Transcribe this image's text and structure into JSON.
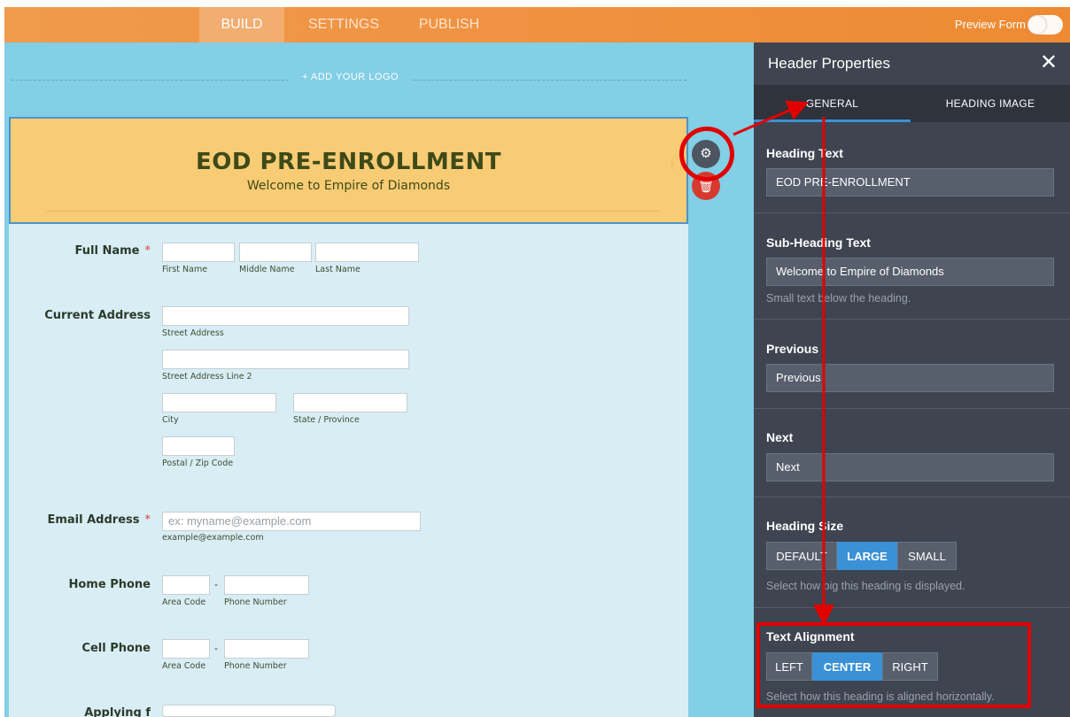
{
  "topbar": {
    "tabs": [
      "BUILD",
      "SETTINGS",
      "PUBLISH"
    ],
    "preview_label": "Preview Form"
  },
  "canvas": {
    "add_logo": "+ ADD YOUR LOGO",
    "heading_title": "EOD PRE-ENROLLMENT",
    "heading_subtitle": "Welcome to Empire of Diamonds"
  },
  "form": {
    "full_name": {
      "label": "Full Name",
      "required": "*",
      "sublabels": [
        "First Name",
        "Middle Name",
        "Last Name"
      ]
    },
    "address": {
      "label": "Current Address",
      "sublabels": [
        "Street Address",
        "Street Address Line 2",
        "City",
        "State / Province",
        "Postal / Zip Code"
      ]
    },
    "email": {
      "label": "Email Address",
      "required": "*",
      "placeholder": "ex: myname@example.com",
      "sublabel": "example@example.com"
    },
    "home_phone": {
      "label": "Home Phone",
      "dash": "-",
      "sublabels": [
        "Area Code",
        "Phone Number"
      ]
    },
    "cell_phone": {
      "label": "Cell Phone",
      "dash": "-",
      "sublabels": [
        "Area Code",
        "Phone Number"
      ]
    },
    "cut_label": "Applying f"
  },
  "panel": {
    "title": "Header Properties",
    "tabs": [
      "GENERAL",
      "HEADING IMAGE"
    ],
    "heading_text": {
      "label": "Heading Text",
      "value": "EOD PRE-ENROLLMENT"
    },
    "sub_heading": {
      "label": "Sub-Heading Text",
      "value": "Welcome to Empire of Diamonds",
      "hint": "Small text below the heading."
    },
    "previous": {
      "label": "Previous",
      "value": "Previous"
    },
    "next": {
      "label": "Next",
      "value": "Next"
    },
    "heading_size": {
      "label": "Heading Size",
      "options": [
        "DEFAULT",
        "LARGE",
        "SMALL"
      ],
      "selected": "LARGE",
      "hint": "Select how big this heading is displayed."
    },
    "text_alignment": {
      "label": "Text Alignment",
      "options": [
        "LEFT",
        "CENTER",
        "RIGHT"
      ],
      "selected": "CENTER",
      "hint": "Select how this heading is aligned horizontally."
    }
  },
  "colors": {
    "topbar": "#ee8a33",
    "canvas": "#82cfe6",
    "header_card": "#f8cb75",
    "panel": "#3e4450",
    "accent": "#3b91d6",
    "annotation": "#e10000"
  }
}
